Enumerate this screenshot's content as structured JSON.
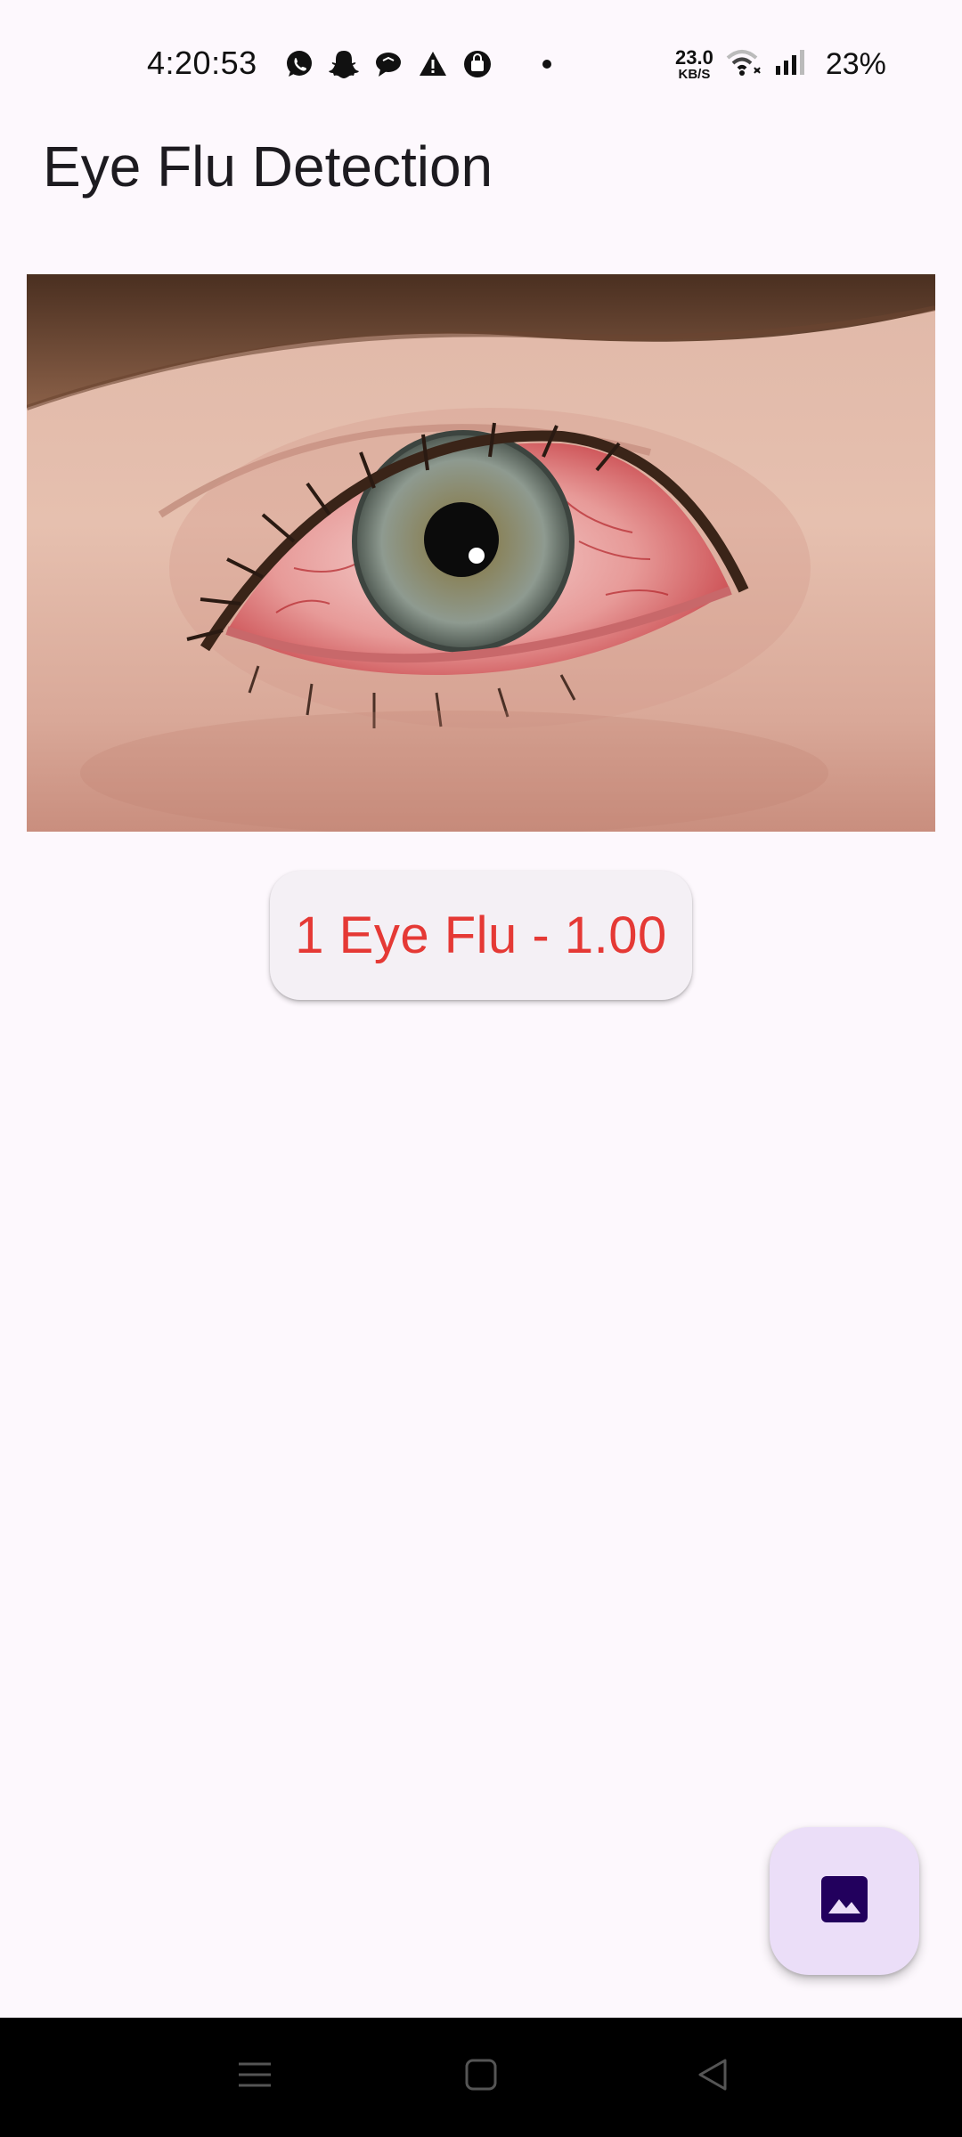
{
  "status_bar": {
    "time": "4:20:53",
    "net_speed_value": "23.0",
    "net_speed_unit": "KB/S",
    "battery": "23%",
    "icons": [
      "whatsapp-icon",
      "snapchat-icon",
      "chat-bubble-icon",
      "warning-icon",
      "shopping-bag-icon",
      "dot-icon",
      "wifi-icon",
      "signal-icon"
    ]
  },
  "app_bar": {
    "title": "Eye Flu Detection"
  },
  "main": {
    "image_subject": "eye-photo",
    "result_label": "1 Eye Flu - 1.00",
    "result_color": "#e53935"
  },
  "fab": {
    "icon": "image-icon",
    "background": "#ebdef8",
    "icon_color": "#22005d"
  },
  "nav_bar": {
    "buttons": [
      "menu-icon",
      "home-icon",
      "back-icon"
    ]
  },
  "colors": {
    "background": "#fdf8fd",
    "chip_background": "#f4f0f5"
  }
}
